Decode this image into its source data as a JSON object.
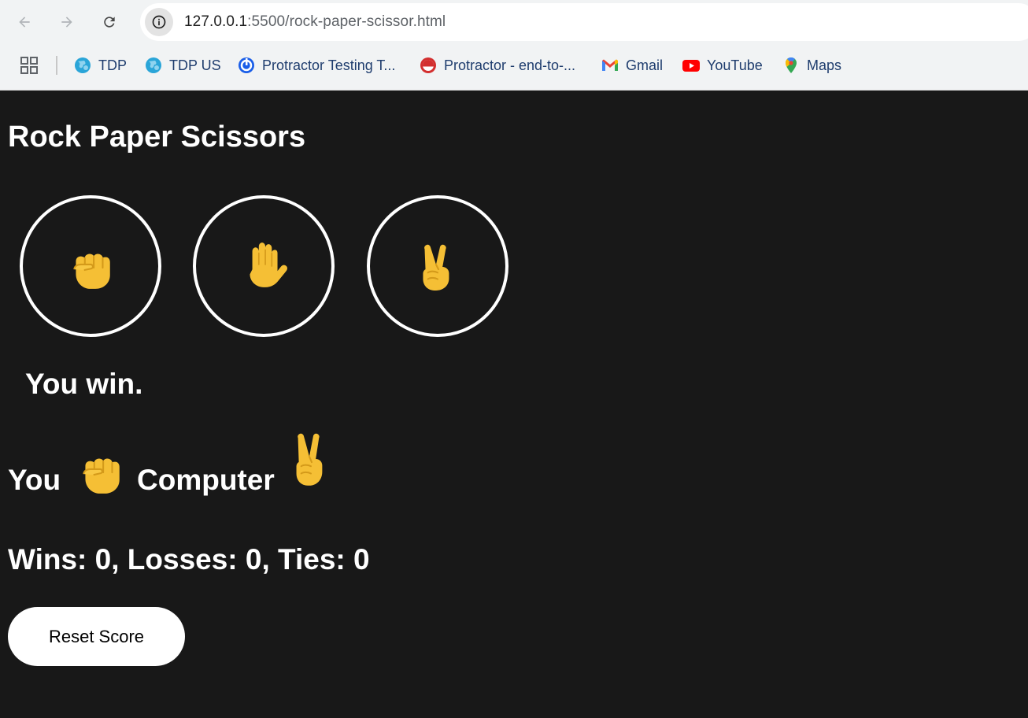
{
  "browser": {
    "url_host": "127.0.0.1",
    "url_rest": ":5500/rock-paper-scissor.html",
    "bookmarks": [
      {
        "label": "TDP",
        "icon": "globe-icon"
      },
      {
        "label": "TDP US",
        "icon": "globe-icon"
      },
      {
        "label": "Protractor Testing T...",
        "icon": "protractor-testing-icon"
      },
      {
        "label": "Protractor - end-to-...",
        "icon": "protractor-icon"
      },
      {
        "label": "Gmail",
        "icon": "gmail-icon"
      },
      {
        "label": "YouTube",
        "icon": "youtube-icon"
      },
      {
        "label": "Maps",
        "icon": "maps-icon"
      }
    ]
  },
  "game": {
    "title": "Rock Paper Scissors",
    "moves": [
      {
        "name": "rock",
        "icon": "rock-fist-icon"
      },
      {
        "name": "paper",
        "icon": "paper-hand-icon"
      },
      {
        "name": "scissors",
        "icon": "scissors-victory-icon"
      }
    ],
    "result": "You win.",
    "you_label": "You",
    "you_move": "rock",
    "computer_label": "Computer",
    "computer_move": "scissors",
    "score": "Wins: 0, Losses: 0, Ties: 0",
    "reset_label": "Reset Score"
  },
  "colors": {
    "page_background": "#181818",
    "text": "#ffffff",
    "emoji_skin": "#f5bf35"
  }
}
